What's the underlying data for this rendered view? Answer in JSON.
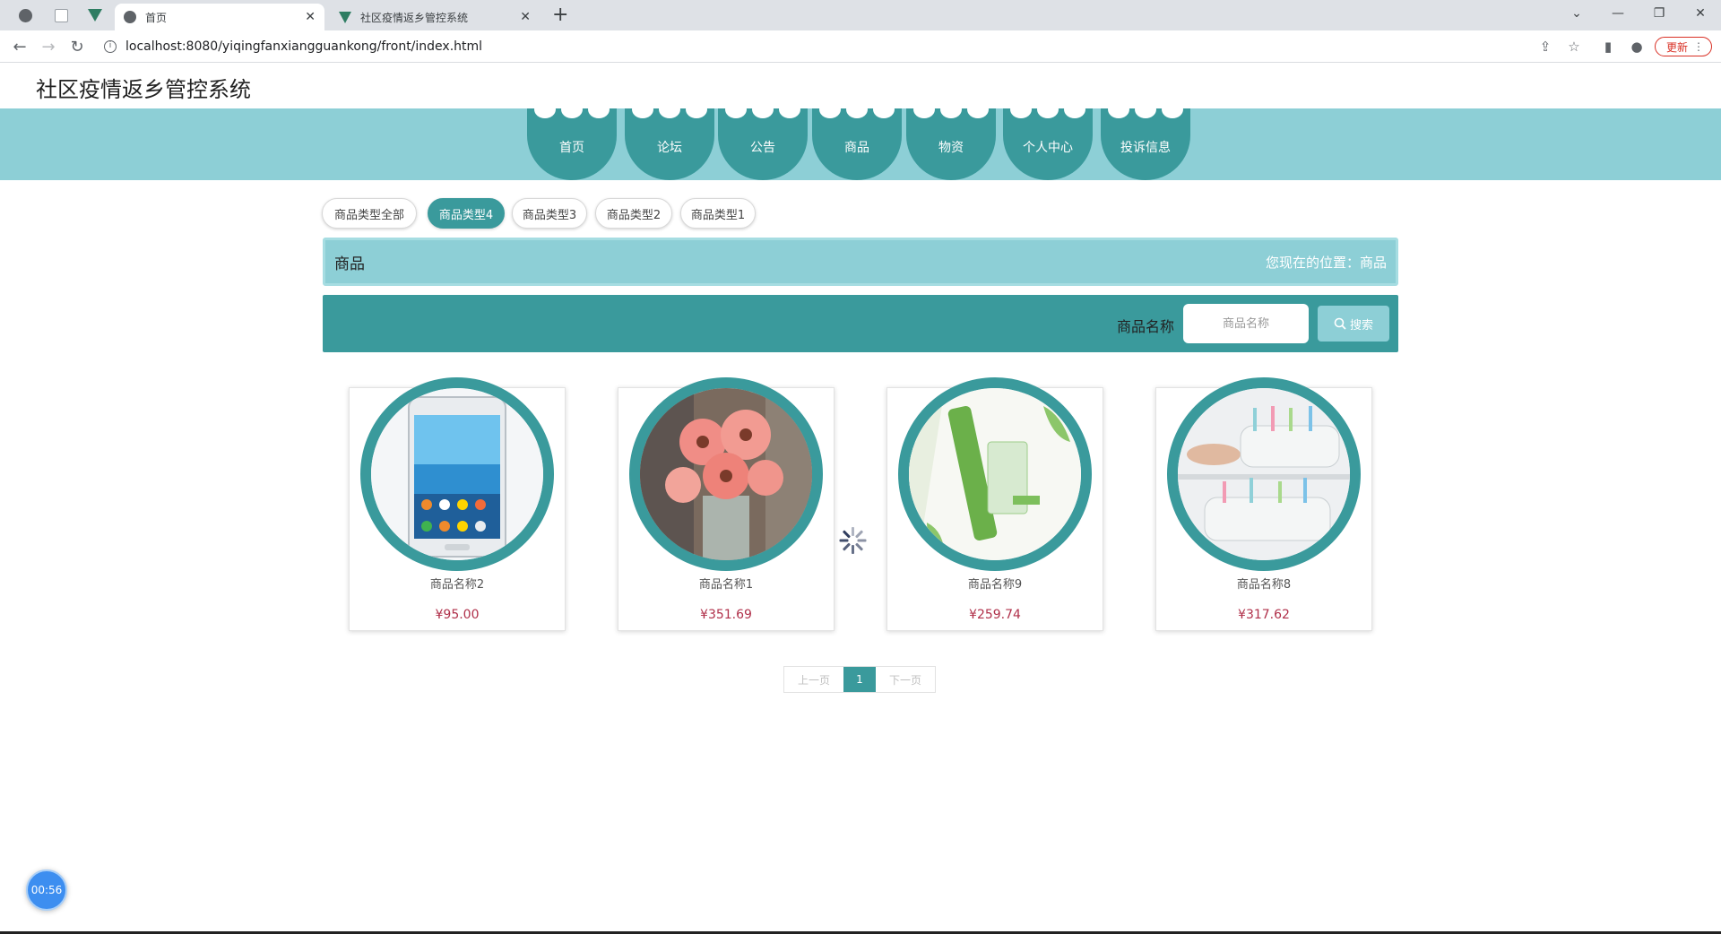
{
  "browser": {
    "tabs": [
      {
        "title": "首页",
        "active": true
      },
      {
        "title": "社区疫情返乡管控系统",
        "active": false
      }
    ],
    "tab_close": "✕",
    "new_tab": "+",
    "url": "localhost:8080/yiqingfanxiangguankong/front/index.html",
    "update_label": "更新",
    "window_controls": {
      "minimize": "—",
      "restore": "❐",
      "close": "✕",
      "dropdown": "⌄"
    }
  },
  "site": {
    "title": "社区疫情返乡管控系统",
    "nav": [
      "首页",
      "论坛",
      "公告",
      "商品",
      "物资",
      "个人中心",
      "投诉信息"
    ]
  },
  "categories": {
    "items": [
      "商品类型全部",
      "商品类型4",
      "商品类型3",
      "商品类型2",
      "商品类型1"
    ],
    "active_index": 1
  },
  "breadcrumb": {
    "section": "商品",
    "location": "您现在的位置：商品"
  },
  "search": {
    "label": "商品名称",
    "placeholder": "商品名称",
    "button": "搜索"
  },
  "products": [
    {
      "name": "商品名称2",
      "price": "¥95.00",
      "image": "phone"
    },
    {
      "name": "商品名称1",
      "price": "¥351.69",
      "image": "flowers"
    },
    {
      "name": "商品名称9",
      "price": "¥259.74",
      "image": "skincare"
    },
    {
      "name": "商品名称8",
      "price": "¥317.62",
      "image": "toothbrush-holder"
    }
  ],
  "pagination": {
    "prev": "上一页",
    "current": "1",
    "next": "下一页"
  },
  "timer": "00:56",
  "colors": {
    "primary": "#3a9a9c",
    "light": "#8dcfd6",
    "price": "#b0304a"
  }
}
